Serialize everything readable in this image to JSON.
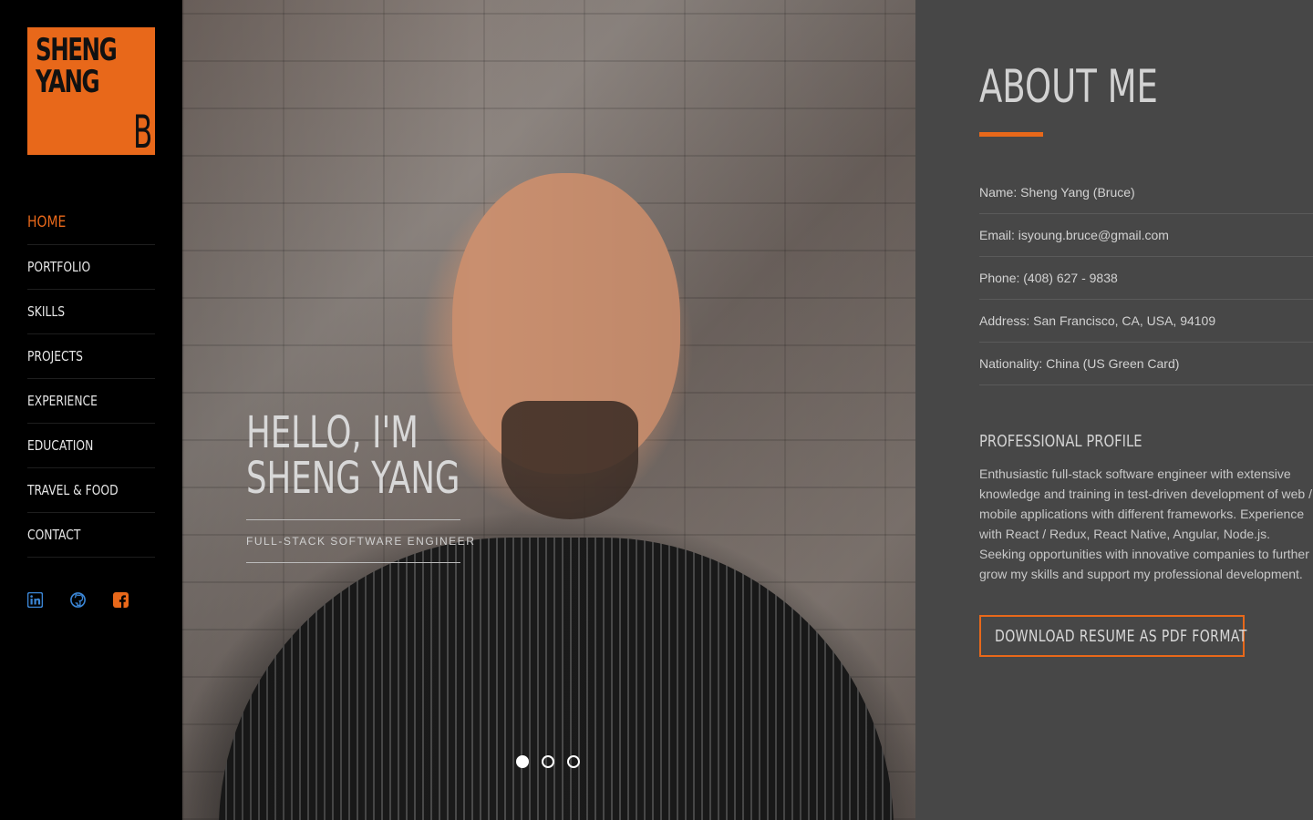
{
  "logo": {
    "line1": "SHENG",
    "line2": "YANG",
    "mark": "B",
    "color": "#e8681a"
  },
  "nav": {
    "items": [
      {
        "label": "HOME",
        "active": true
      },
      {
        "label": "PORTFOLIO"
      },
      {
        "label": "SKILLS"
      },
      {
        "label": "PROJECTS"
      },
      {
        "label": "EXPERIENCE"
      },
      {
        "label": "EDUCATION"
      },
      {
        "label": "TRAVEL & FOOD"
      },
      {
        "label": "CONTACT"
      }
    ]
  },
  "social": {
    "icons": [
      "linkedin-icon",
      "github-icon",
      "facebook-icon"
    ],
    "colors": {
      "linkedin": "#3b86d6",
      "github": "#3b86d6",
      "facebook": "#e8681a"
    }
  },
  "hero": {
    "greeting_line1": "HELLO, I'M",
    "greeting_line2": "SHENG YANG",
    "tagline": "FULL-STACK SOFTWARE ENGINEER",
    "slides_total": 3,
    "active_slide": 1
  },
  "about": {
    "title": "ABOUT ME",
    "info": [
      "Name: Sheng Yang (Bruce)",
      "Email: isyoung.bruce@gmail.com",
      "Phone: (408) 627 - 9838",
      "Address: San Francisco, CA, USA, 94109",
      "Nationality: China (US Green Card)"
    ],
    "profile_heading": "PROFESSIONAL PROFILE",
    "profile_text": "Enthusiastic full-stack software engineer with extensive knowledge and training in test-driven development of web / mobile applications with different frameworks. Experience with React / Redux, React Native, Angular, Node.js. Seeking opportunities with innovative companies to further grow my skills and support my professional development.",
    "download_label": "DOWNLOAD RESUME AS PDF FORMAT"
  }
}
